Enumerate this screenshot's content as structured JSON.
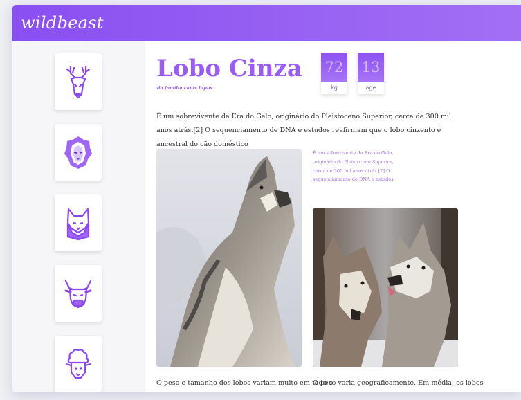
{
  "app": {
    "brand": "wildbeast"
  },
  "sidebar": {
    "items": [
      {
        "icon": "deer-icon"
      },
      {
        "icon": "lion-icon"
      },
      {
        "icon": "fox-icon"
      },
      {
        "icon": "bull-icon"
      },
      {
        "icon": "sheep-icon"
      }
    ]
  },
  "animal": {
    "name": "Lobo Cinza",
    "family": "da família canis lupus",
    "stats": [
      {
        "value": "72",
        "label": "kg"
      },
      {
        "value": "13",
        "label": "age"
      }
    ],
    "intro": "É um sobrevivente da Era do Gelo, originário do Pleistoceno Superior, cerca de 300 mil anos atrás.[2] O sequenciamento de DNA e estudos reafirmam que o lobo cinzento é ancestral do cão doméstico",
    "side_note": "É um sobrevivente da Era do Gelo, originário do Pleistoceno Superior, cerca de 300 mil anos atrás.[2] O sequenciamento de DNA e estudos.",
    "col1_text": "O peso e tamanho dos lobos variam muito em todo o",
    "col2_text": "O peso varia geograficamente. Em média, os lobos"
  },
  "colors": {
    "accent": "#9a5cf3",
    "header_start": "#8a4ff1",
    "header_end": "#a26ff4"
  },
  "images": {
    "photo1": "howling wolf in snow",
    "photo2": "two wolves nuzzling"
  }
}
